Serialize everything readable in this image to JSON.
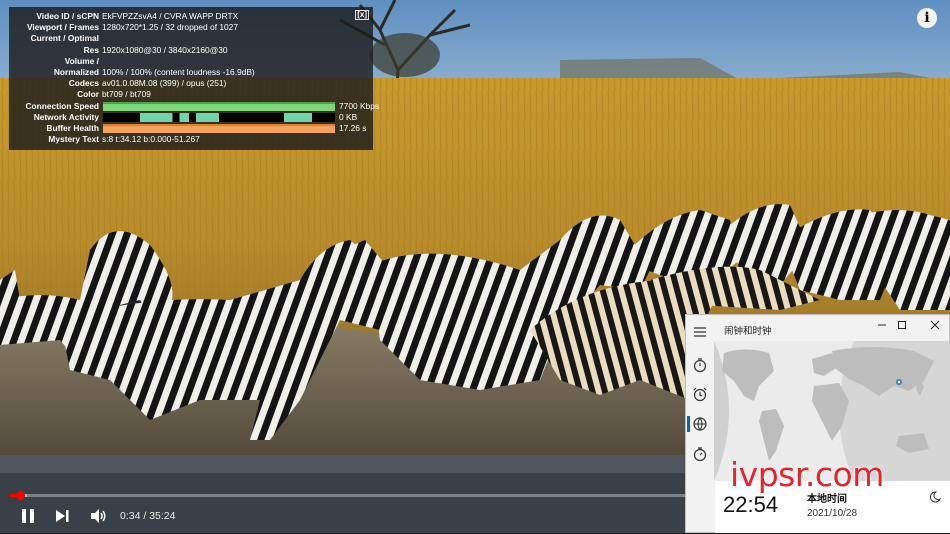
{
  "stats": {
    "rows": [
      {
        "key": "Video ID / sCPN",
        "value": "EkFVPZZsvA4 / CVRA WAPP DRTX"
      },
      {
        "key": "Viewport / Frames",
        "value": "1280x720*1.25 / 32 dropped of 1027"
      },
      {
        "key": "Current / Optimal",
        "value": ""
      },
      {
        "key": "Res",
        "value": "1920x1080@30 / 3840x2160@30"
      },
      {
        "key": "Volume /",
        "value": ""
      },
      {
        "key": "Normalized",
        "value": "100% / 100% (content loudness -16.9dB)"
      },
      {
        "key": "Codecs",
        "value": "av01.0.08M.08 (399) / opus (251)"
      },
      {
        "key": "Color",
        "value": "bt709 / bt709"
      },
      {
        "key": "Connection Speed",
        "value": "7700 Kbps"
      },
      {
        "key": "Network Activity",
        "value": "0 KB"
      },
      {
        "key": "Buffer Health",
        "value": "17.26 s"
      },
      {
        "key": "Mystery Text",
        "value": "s:8 t:34.12 b:0.000-51.267"
      }
    ],
    "close_label": "[x]",
    "colors": {
      "speed": "#7ed67a",
      "network": "#6fd3ae",
      "buffer": "#f3a25c"
    }
  },
  "player": {
    "info_label": "i",
    "time": "0:34 / 35:24",
    "progress_fraction": 0.016,
    "buffer_fraction": 0.025,
    "accent": "#ff0000"
  },
  "clock_app": {
    "title": "闹钟和时钟",
    "nav_icons": [
      "menu-icon",
      "timer-icon",
      "alarm-icon",
      "world-clock-icon",
      "stopwatch-icon"
    ],
    "local": {
      "time": "22:54",
      "place": "本地时间",
      "date": "2021/10/28"
    }
  },
  "watermark": "ivpsr.com"
}
